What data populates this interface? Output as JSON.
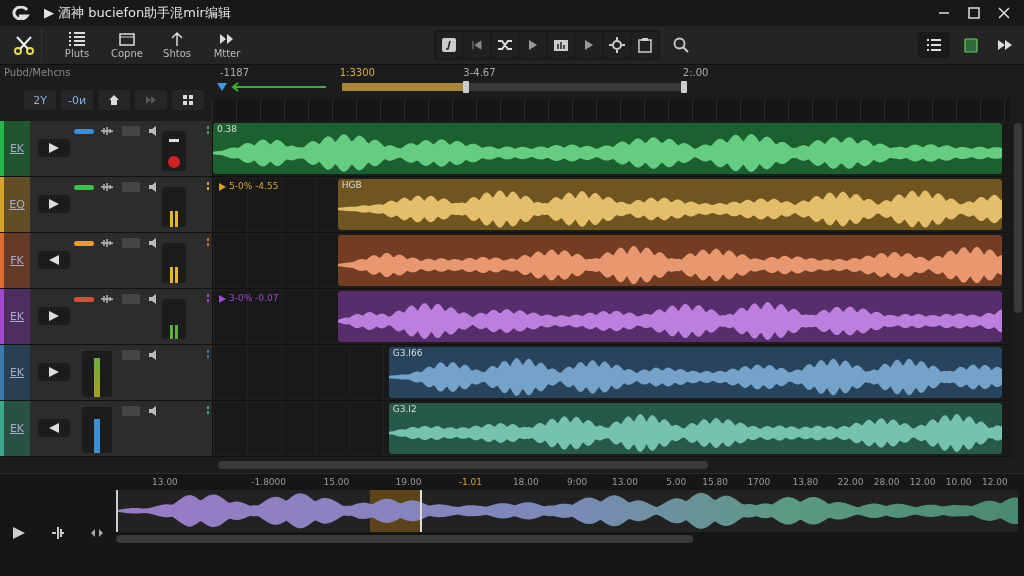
{
  "window": {
    "title": "▶ 酒神 buciefon助手混mir编辑"
  },
  "toolbar": {
    "tools": [
      {
        "label": "Pluts"
      },
      {
        "label": "Copne"
      },
      {
        "label": "Shtos"
      },
      {
        "label": "Mtter"
      }
    ]
  },
  "panel": {
    "label": "Pubd/Mehcns",
    "buttons": [
      "2Y",
      "-0и"
    ]
  },
  "timeline": {
    "markers": [
      "-1187",
      "1:3300",
      "3-4.67",
      "2:.00"
    ],
    "range": {
      "level": 0.36
    }
  },
  "tracks": [
    {
      "label": "EK",
      "color": "#22b84a",
      "kind": "fader",
      "armed": true,
      "send": {
        "color": "#3a8fd6"
      },
      "level": 0.7,
      "clip": {
        "kind": "full",
        "title": "0.38"
      }
    },
    {
      "label": "EQ",
      "color": "#d9a22a",
      "kind": "fader",
      "armed": false,
      "send": {
        "color": "#3cc04a"
      },
      "level": 0.4,
      "lead": "5-0% -4.55",
      "clip": {
        "kind": "late",
        "title": "HGB"
      }
    },
    {
      "label": "FK",
      "color": "#e06a30",
      "kind": "fader",
      "armed": false,
      "send": {
        "color": "#e8a020"
      },
      "level": 0.4,
      "clip": {
        "kind": "late"
      }
    },
    {
      "label": "EK",
      "color": "#a048d0",
      "kind": "fader",
      "armed": false,
      "send": {
        "color": "#e04a3a"
      },
      "level": 0.35,
      "lead": "3-0% -0.07",
      "clip": {
        "kind": "late"
      }
    },
    {
      "label": "EK",
      "color": "#3a7ab0",
      "kind": "meter",
      "armed": false,
      "level": 0.85,
      "clip": {
        "kind": "later",
        "title": "G3.I66"
      }
    },
    {
      "label": "EK",
      "color": "#3aa88a",
      "kind": "meter",
      "armed": false,
      "level": 0.75,
      "clip": {
        "kind": "later",
        "title": "G3.I2"
      }
    }
  ],
  "overview": {
    "ticks": [
      "13.00",
      "-1.8000",
      "15.00",
      "19.00",
      "-1.01",
      "18.00",
      "9:00",
      "13.00",
      "5.00",
      "15.80",
      "1700",
      "13.80",
      "22.00",
      "28.00",
      "12.00",
      "10.00",
      "12.00"
    ]
  }
}
